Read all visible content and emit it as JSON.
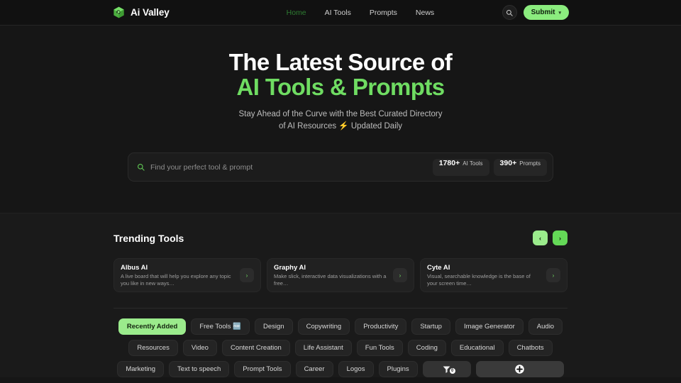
{
  "header": {
    "brand": "Ai Valley",
    "brand_icon": "cube-logo-icon",
    "nav": [
      {
        "label": "Home",
        "active": true
      },
      {
        "label": "AI Tools",
        "active": false
      },
      {
        "label": "Prompts",
        "active": false
      },
      {
        "label": "News",
        "active": false
      }
    ],
    "search_icon": "search-icon",
    "submit_label": "Submit",
    "submit_chevron": "▾"
  },
  "hero": {
    "title_line1": "The Latest Source of",
    "title_line2": "AI Tools & Prompts",
    "subtitle_line1": "Stay Ahead of the Curve with the Best Curated Directory",
    "subtitle_line2": "of AI Resources ⚡ Updated Daily"
  },
  "search": {
    "icon": "search-icon",
    "placeholder": "Find your perfect tool & prompt",
    "value": "",
    "stats": [
      {
        "number": "1780+",
        "label": "AI Tools"
      },
      {
        "number": "390+",
        "label": "Prompts"
      }
    ]
  },
  "trending": {
    "title": "Trending Tools",
    "prev_label": "‹",
    "next_label": "›",
    "cards": [
      {
        "title": "Albus AI",
        "desc": "A live board that will help you explore any topic you like in new ways…",
        "go": "›"
      },
      {
        "title": "Graphy AI",
        "desc": "Make slick, interactive data visualizations with a free…",
        "go": "›"
      },
      {
        "title": "Cyte AI",
        "desc": "Visual, searchable knowledge is the base of your screen time…",
        "go": "›"
      }
    ]
  },
  "categories": {
    "row1": [
      {
        "label": "Recently Added",
        "active": true
      },
      {
        "label": "Free Tools 🆓",
        "active": false
      },
      {
        "label": "Design",
        "active": false
      },
      {
        "label": "Copywriting",
        "active": false
      },
      {
        "label": "Productivity",
        "active": false
      },
      {
        "label": "Startup",
        "active": false
      },
      {
        "label": "Image Generator",
        "active": false
      },
      {
        "label": "Audio",
        "active": false
      }
    ],
    "row2": [
      {
        "label": "Resources",
        "active": false
      },
      {
        "label": "Video",
        "active": false
      },
      {
        "label": "Content Creation",
        "active": false
      },
      {
        "label": "Life Assistant",
        "active": false
      },
      {
        "label": "Fun Tools",
        "active": false
      },
      {
        "label": "Coding",
        "active": false
      },
      {
        "label": "Educational",
        "active": false
      },
      {
        "label": "Chatbots",
        "active": false
      }
    ],
    "row3": [
      {
        "label": "Marketing",
        "active": false
      },
      {
        "label": "Text to speech",
        "active": false
      },
      {
        "label": "Prompt Tools",
        "active": false
      },
      {
        "label": "Career",
        "active": false
      },
      {
        "label": "Logos",
        "active": false
      },
      {
        "label": "Plugins",
        "active": false
      }
    ],
    "filter_button": {
      "icon": "filter-icon",
      "badge": "0"
    },
    "add_button": {
      "icon": "plus-icon"
    }
  },
  "colors": {
    "page_bg": "#161616",
    "section_bg": "#1a1a1a",
    "header_bg": "#111111",
    "accent_green": "#6fdc62",
    "accent_pill": "#9beb8c",
    "nav_active": "#2e7d32"
  }
}
